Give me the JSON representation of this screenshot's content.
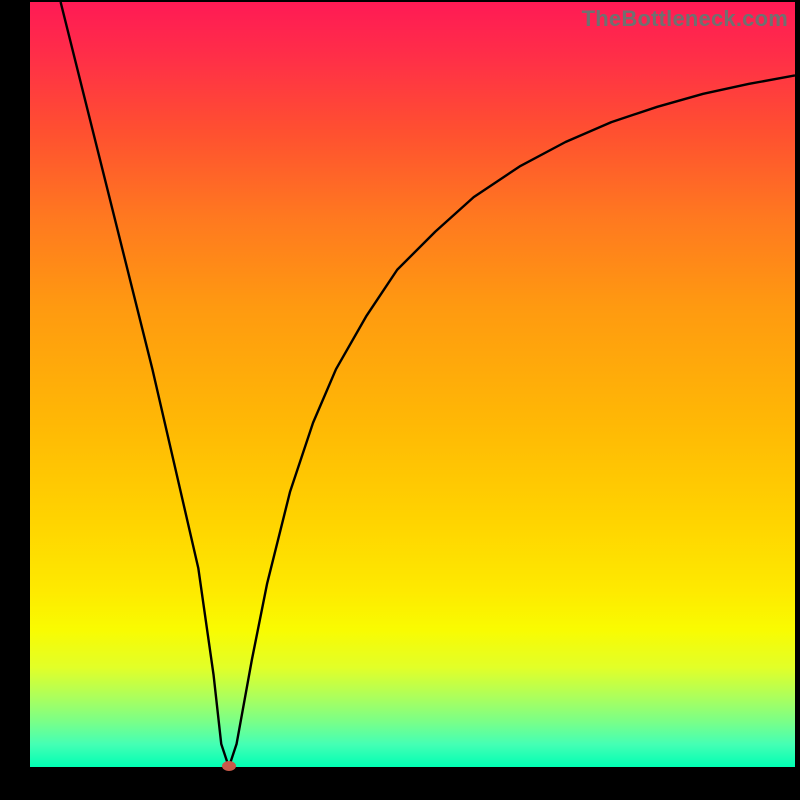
{
  "watermark": "TheBottleneck.com",
  "chart_data": {
    "type": "line",
    "title": "",
    "xlabel": "",
    "ylabel": "",
    "xlim": [
      0,
      100
    ],
    "ylim": [
      0,
      100
    ],
    "series": [
      {
        "name": "curve",
        "x": [
          4,
          7,
          10,
          13,
          16,
          19,
          22,
          24,
          25,
          26,
          27,
          29,
          31,
          34,
          37,
          40,
          44,
          48,
          53,
          58,
          64,
          70,
          76,
          82,
          88,
          94,
          100
        ],
        "values": [
          100,
          88,
          76,
          64,
          52,
          39,
          26,
          12,
          3,
          0,
          3,
          14,
          24,
          36,
          45,
          52,
          59,
          65,
          70,
          74.5,
          78.5,
          81.7,
          84.3,
          86.3,
          88,
          89.3,
          90.4
        ]
      }
    ],
    "marker": {
      "x": 26,
      "y": 0,
      "color": "#c85a4a"
    },
    "background": "vertical-gradient red-orange-yellow-green"
  }
}
